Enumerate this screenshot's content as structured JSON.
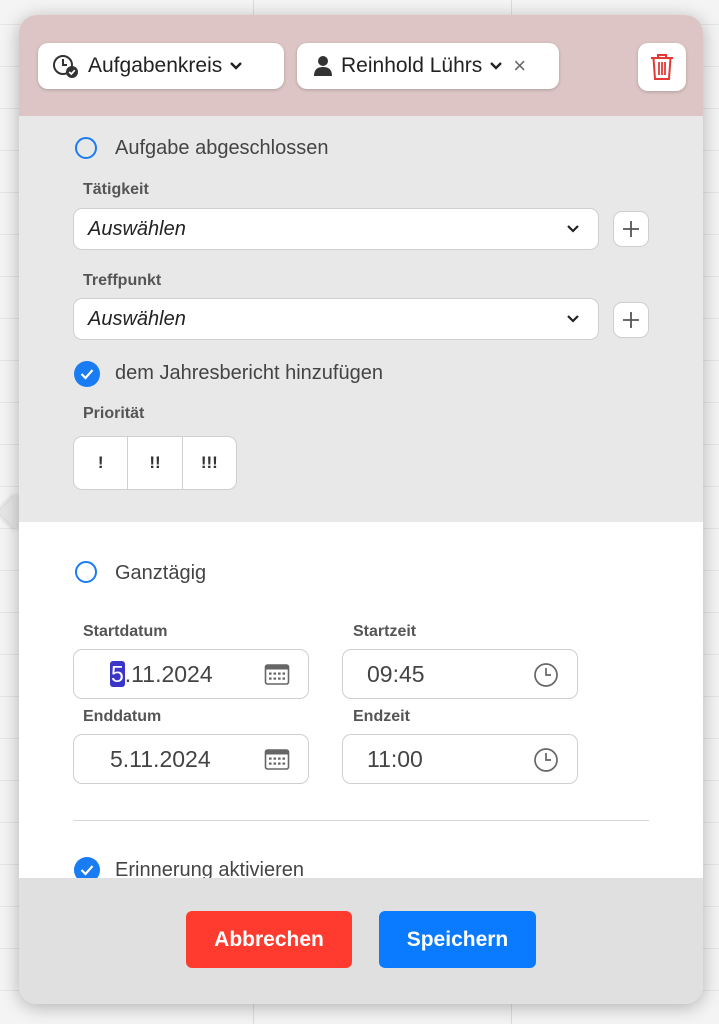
{
  "header": {
    "circle_chip": "Aufgabenkreis",
    "assignee_chip": "Reinhold Lührs",
    "remove_symbol": "×"
  },
  "task": {
    "completed_label": "Aufgabe abgeschlossen",
    "activity_label": "Tätigkeit",
    "activity_value": "Auswählen",
    "meeting_label": "Treffpunkt",
    "meeting_value": "Auswählen",
    "annual_report_label": "dem Jahresbericht hinzufügen",
    "priority_label": "Priorität",
    "priority_options": [
      "!",
      "!!",
      "!!!"
    ]
  },
  "schedule": {
    "allday_label": "Ganztägig",
    "start_date_label": "Startdatum",
    "start_date_highlight": "5",
    "start_date_rest": ".11.2024",
    "start_time_label": "Startzeit",
    "start_time": "09:45",
    "end_date_label": "Enddatum",
    "end_date": "5.11.2024",
    "end_time_label": "Endzeit",
    "end_time": "11:00",
    "reminder_label": "Erinnerung aktivieren"
  },
  "footer": {
    "cancel": "Abbrechen",
    "save": "Speichern"
  },
  "colors": {
    "header_bg": "#dcc5c4",
    "accent_blue": "#1a7cf2",
    "cancel_red": "#ff3b30",
    "save_blue": "#0a7aff",
    "trash_red": "#e53935"
  },
  "icons": [
    "clock-check-icon",
    "chevron-down-icon",
    "person-icon",
    "close-icon",
    "trash-icon",
    "plus-icon",
    "calendar-icon",
    "clock-icon",
    "checkmark-icon"
  ]
}
